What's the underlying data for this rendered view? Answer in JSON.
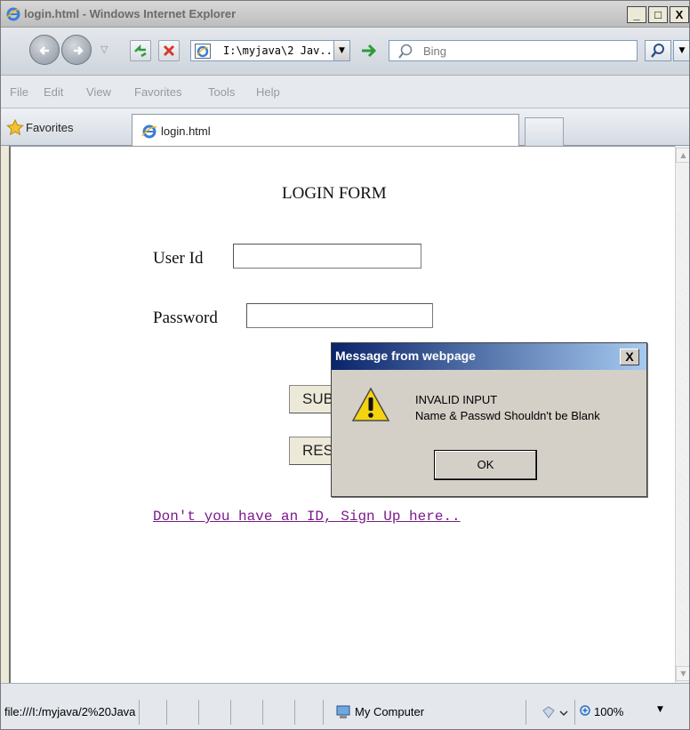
{
  "window": {
    "title": "login.html - Windows Internet Explorer",
    "minimize": "_",
    "maximize": "□",
    "close": "X"
  },
  "navbar": {
    "address": "I:\\myjava\\2 Jav...",
    "search_placeholder": "Bing"
  },
  "menu": [
    "File",
    "Edit",
    "View",
    "Favorites",
    "Tools",
    "Help"
  ],
  "favorites": {
    "label": "Favorites",
    "tab_label": "login.html"
  },
  "page": {
    "title": "LOGIN FORM",
    "user_label": "User Id",
    "user_value": "",
    "password_label": "Password",
    "password_value": "",
    "submit_label": "SUBMIT",
    "reset_label": "RESET",
    "signup_link": "Don't you have an ID, Sign Up here.."
  },
  "dialog": {
    "title": "Message from webpage",
    "close": "X",
    "line1": "INVALID INPUT",
    "line2": "Name & Passwd Shouldn't be Blank",
    "ok_label": "OK"
  },
  "status": {
    "url": "file:///I:/myjava/2%20Java",
    "zone": "My Computer",
    "zoom": "100%"
  },
  "colors": {
    "dialog_title_start": "#0a246a",
    "dialog_title_end": "#a6caf0",
    "link": "#7a1a8c"
  }
}
